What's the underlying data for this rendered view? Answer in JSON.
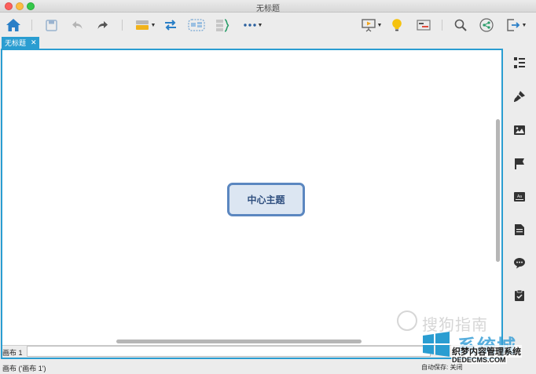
{
  "window": {
    "title": "无标题"
  },
  "toolbar": {
    "items": [
      {
        "name": "home"
      },
      {
        "name": "save"
      },
      {
        "name": "undo"
      },
      {
        "name": "redo"
      },
      {
        "name": "insert-topic"
      },
      {
        "name": "relationship"
      },
      {
        "name": "boundary"
      },
      {
        "name": "summary"
      },
      {
        "name": "more"
      },
      {
        "name": "presentation"
      },
      {
        "name": "brainstorm"
      },
      {
        "name": "gantt"
      },
      {
        "name": "search"
      },
      {
        "name": "share"
      },
      {
        "name": "export"
      }
    ]
  },
  "tab": {
    "label": "无标题",
    "close": "✕"
  },
  "canvas": {
    "central_topic": "中心主题"
  },
  "sheet": {
    "label": "画布 1"
  },
  "status": {
    "left": "画布 ('画布 1')",
    "right": "自动保存: 关闭"
  },
  "right_panel": {
    "items": [
      "outline-icon",
      "format-icon",
      "image-icon",
      "marker-icon",
      "style-icon",
      "notes-icon",
      "comments-icon",
      "task-icon"
    ]
  },
  "watermarks": {
    "sogou": "搜狗指南",
    "xitong": "系统城",
    "dedecms_line1": "织梦内容管理系统",
    "dedecms_line2": "DEDECMS.COM"
  },
  "colors": {
    "accent": "#2a9dd1",
    "topic_border": "#5b87c0",
    "topic_fill": "#dce6f2"
  }
}
